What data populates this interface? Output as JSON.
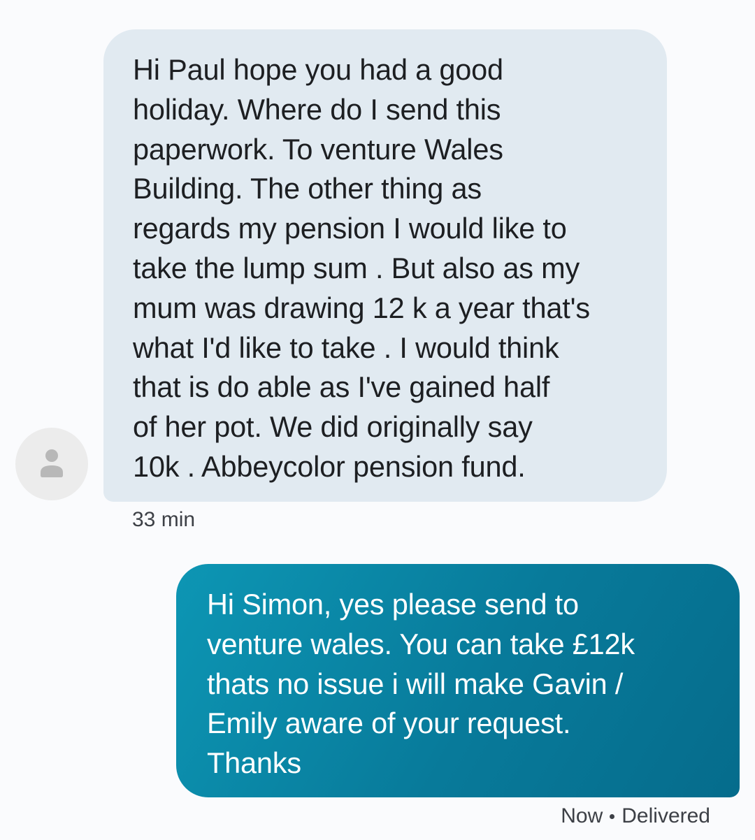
{
  "incoming_message": {
    "text": "Hi Paul hope you had a good\nholiday. Where do I send this\npaperwork.  To venture Wales\nBuilding.  The other thing as\nregards my pension I would like to\ntake the lump sum . But also as my\nmum was drawing 12 k a year that's\nwhat I'd like to take . I would think\nthat is do able as I've gained half\nof her pot. We did originally say\n10k . Abbeycolor pension fund.",
    "timestamp": "33 min",
    "avatar_icon": "person-icon",
    "bubble_color": "#e1eaf1"
  },
  "outgoing_message": {
    "text": "Hi Simon, yes please send to\nventure wales. You can take £12k\nthats no issue i will make Gavin /\nEmily aware of your request.\nThanks",
    "time": "Now",
    "status": "Delivered",
    "bubble_color": "#0a85a5"
  }
}
